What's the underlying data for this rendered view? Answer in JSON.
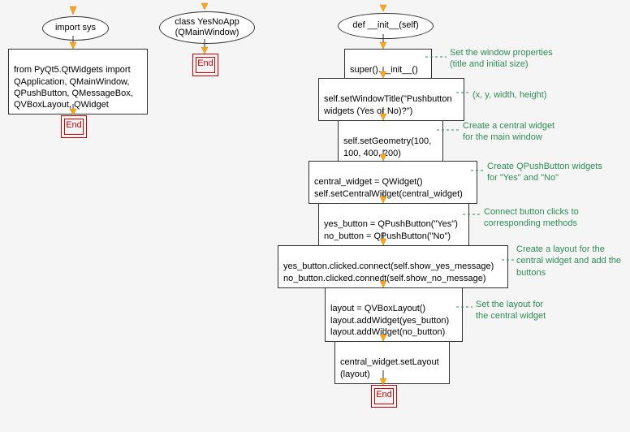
{
  "col1": {
    "start": "import sys",
    "box": "from PyQt5.QtWidgets import\nQApplication, QMainWindow,\nQPushButton, QMessageBox,\nQVBoxLayout, QWidget",
    "end": "End"
  },
  "col2": {
    "start": "class YesNoApp\n(QMainWindow)",
    "end": "End"
  },
  "col3": {
    "start": "def __init__(self)",
    "n1": "super().__init__()",
    "n2": "self.setWindowTitle(\"Pushbutton\nwidgets (Yes or No)?\")",
    "n3": "self.setGeometry(100,\n100, 400, 200)",
    "n4": "central_widget = QWidget()\nself.setCentralWidget(central_widget)",
    "n5": "yes_button = QPushButton(\"Yes\")\nno_button = QPushButton(\"No\")",
    "n6": "yes_button.clicked.connect(self.show_yes_message)\nno_button.clicked.connect(self.show_no_message)",
    "n7": "layout = QVBoxLayout()\nlayout.addWidget(yes_button)\nlayout.addWidget(no_button)",
    "n8": "central_widget.setLayout\n(layout)",
    "end": "End",
    "c1": "Set the window properties\n(title and initial size)",
    "c2": "(x, y, width, height)",
    "c3": "Create a central widget\nfor the main window",
    "c4": "Create QPushButton widgets\nfor \"Yes\" and \"No\"",
    "c5": "Connect button clicks to\ncorresponding methods",
    "c6": "Create a layout for the\ncentral widget and add the\nbuttons",
    "c7": "Set the layout for\nthe central widget"
  }
}
